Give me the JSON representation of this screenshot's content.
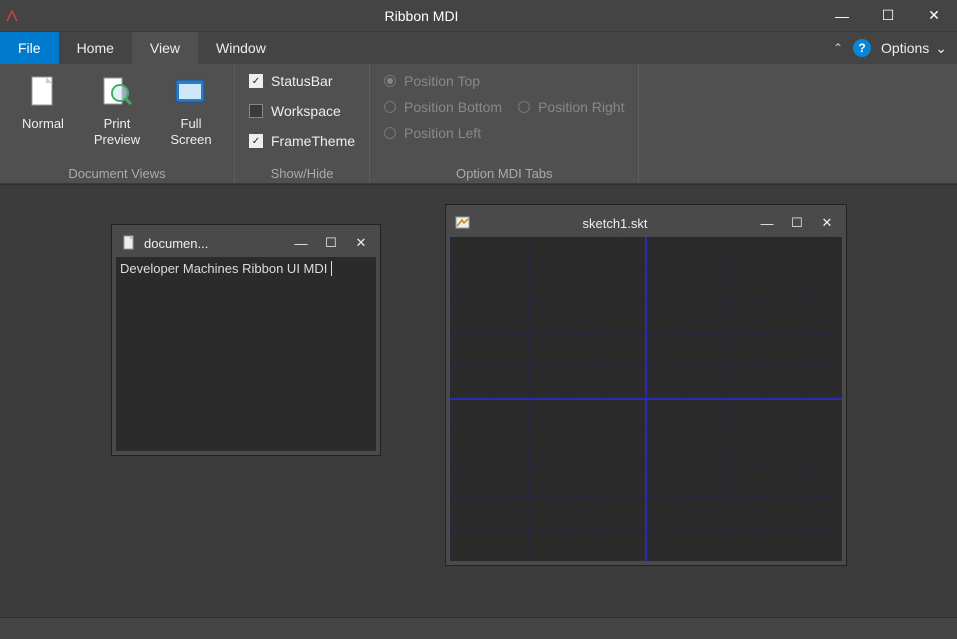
{
  "window": {
    "title": "Ribbon MDI",
    "controls": {
      "minimize": "—",
      "maximize": "☐",
      "close": "✕"
    }
  },
  "tabs": {
    "file": "File",
    "items": [
      "Home",
      "View",
      "Window"
    ],
    "active": "View",
    "collapse_glyph": "⌃",
    "help_glyph": "?",
    "options_label": "Options",
    "options_caret": "⌄"
  },
  "ribbon": {
    "groups": {
      "documentViews": {
        "caption": "Document Views",
        "buttons": {
          "normal": "Normal",
          "printPreview1": "Print",
          "printPreview2": "Preview",
          "fullScreen1": "Full",
          "fullScreen2": "Screen"
        }
      },
      "showHide": {
        "caption": "Show/Hide",
        "items": {
          "statusBar": {
            "label": "StatusBar",
            "checked": true
          },
          "workspace": {
            "label": "Workspace",
            "checked": false
          },
          "frameTheme": {
            "label": "FrameTheme",
            "checked": true
          }
        }
      },
      "mdiTabs": {
        "caption": "Option MDI Tabs",
        "radios": {
          "top": {
            "label": "Position Top",
            "selected": true
          },
          "bottom": {
            "label": "Position Bottom",
            "selected": false
          },
          "left": {
            "label": "Position Left",
            "selected": false
          },
          "right": {
            "label": "Position Right",
            "selected": false
          }
        }
      }
    }
  },
  "mdi": {
    "doc": {
      "title": "documen...",
      "text": "Developer Machines Ribbon UI MDI"
    },
    "sketch": {
      "title": "sketch1.skt"
    },
    "childControls": {
      "min": "—",
      "max": "☐",
      "close": "✕"
    }
  }
}
